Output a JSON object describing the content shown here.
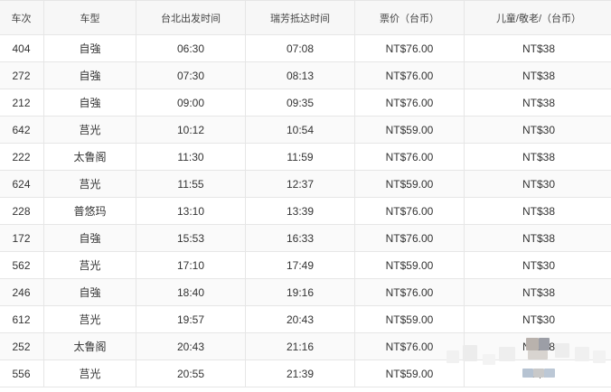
{
  "table": {
    "headers": [
      "车次",
      "车型",
      "台北出发时间",
      "瑞芳抵达时间",
      "票价（台币）",
      "儿童/敬老/（台币）"
    ],
    "rows": [
      [
        "404",
        "自強",
        "06:30",
        "07:08",
        "NT$76.00",
        "NT$38"
      ],
      [
        "272",
        "自強",
        "07:30",
        "08:13",
        "NT$76.00",
        "NT$38"
      ],
      [
        "212",
        "自強",
        "09:00",
        "09:35",
        "NT$76.00",
        "NT$38"
      ],
      [
        "642",
        "莒光",
        "10:12",
        "10:54",
        "NT$59.00",
        "NT$30"
      ],
      [
        "222",
        "太鲁阁",
        "11:30",
        "11:59",
        "NT$76.00",
        "NT$38"
      ],
      [
        "624",
        "莒光",
        "11:55",
        "12:37",
        "NT$59.00",
        "NT$30"
      ],
      [
        "228",
        "普悠玛",
        "13:10",
        "13:39",
        "NT$76.00",
        "NT$38"
      ],
      [
        "172",
        "自強",
        "15:53",
        "16:33",
        "NT$76.00",
        "NT$38"
      ],
      [
        "562",
        "莒光",
        "17:10",
        "17:49",
        "NT$59.00",
        "NT$30"
      ],
      [
        "246",
        "自強",
        "18:40",
        "19:16",
        "NT$76.00",
        "NT$38"
      ],
      [
        "612",
        "莒光",
        "19:57",
        "20:43",
        "NT$59.00",
        "NT$30"
      ],
      [
        "252",
        "太鲁阁",
        "20:43",
        "21:16",
        "NT$76.00",
        "NT$38"
      ],
      [
        "556",
        "莒光",
        "20:55",
        "21:39",
        "NT$59.00",
        "NT$30"
      ]
    ]
  },
  "colors": {
    "border": "#e6e6e6",
    "header_bg": "#f7f7f7",
    "text": "#333333"
  }
}
